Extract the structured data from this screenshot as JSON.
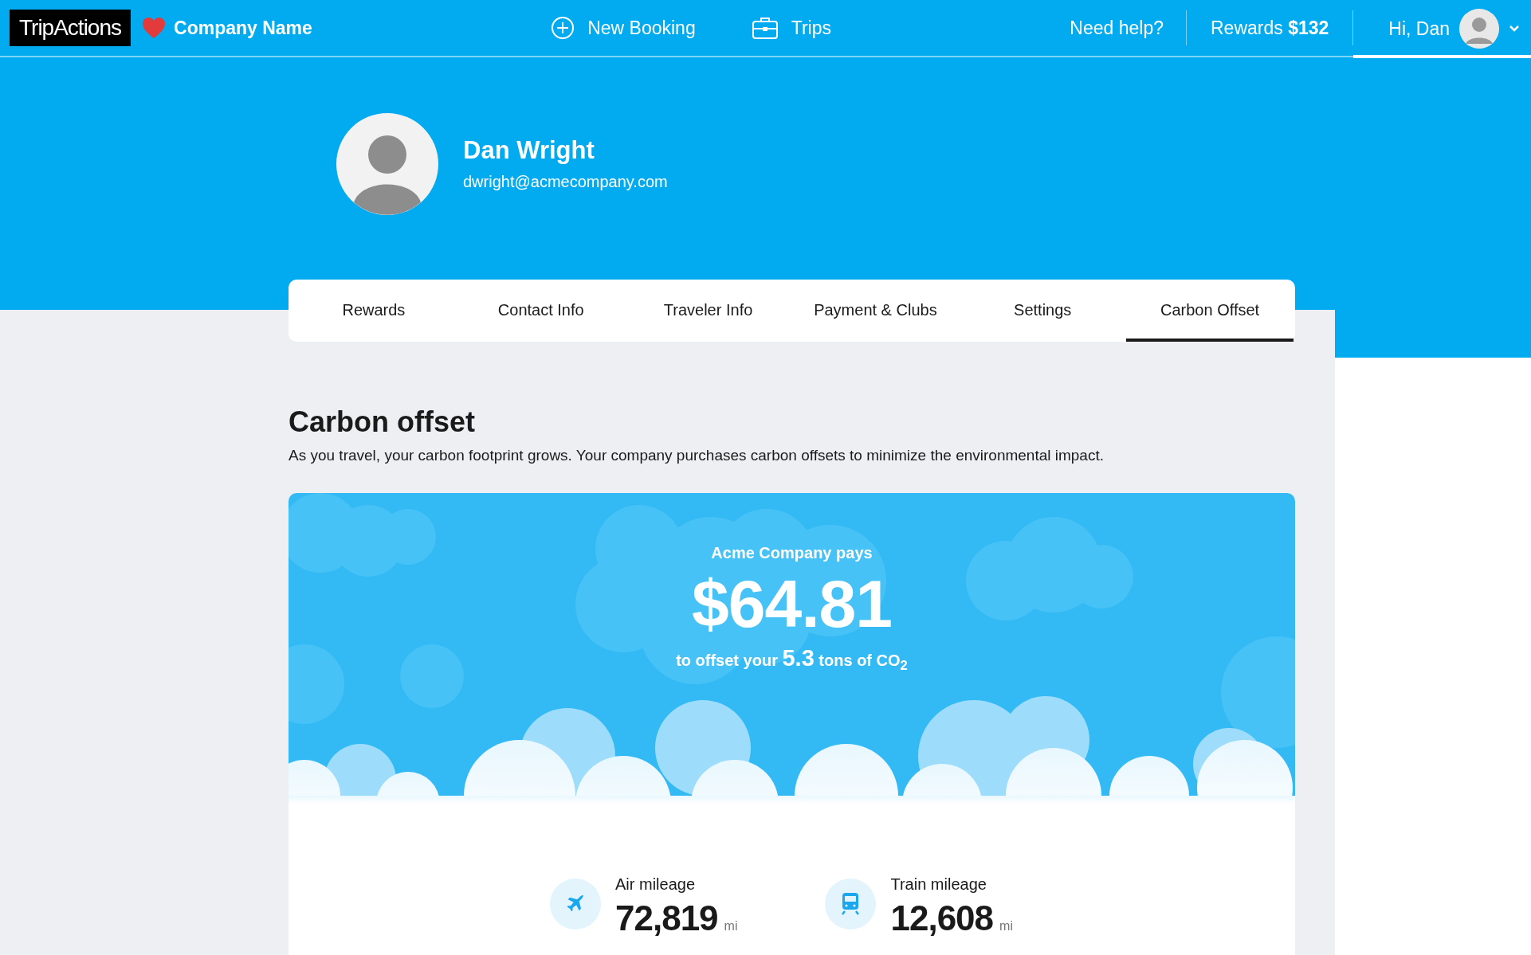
{
  "topbar": {
    "logo": "TripActions",
    "company": "Company Name",
    "nav": [
      {
        "kind": "booking",
        "label": "New Booking"
      },
      {
        "kind": "trips",
        "label": "Trips"
      }
    ],
    "help": "Need help?",
    "rewards": "Rewards **$132**",
    "greeting": "Hi, Dan"
  },
  "profile": {
    "name": "Dan Wright",
    "email": "dwright@acmecompany.com"
  },
  "tabs": [
    {
      "label": "Rewards",
      "selected": false
    },
    {
      "label": "Contact Info",
      "selected": false
    },
    {
      "label": "Traveler Info",
      "selected": false
    },
    {
      "label": "Payment & Clubs",
      "selected": false
    },
    {
      "label": "Settings",
      "selected": false
    },
    {
      "label": "Carbon Offset",
      "selected": true
    }
  ],
  "section": {
    "title": "Carbon offset",
    "description": "As you travel, your carbon footprint grows. Your company purchases carbon offsets to minimize the environmental impact."
  },
  "offset": {
    "payer": "Acme Company pays",
    "amount": "$64.81",
    "detail": "to offset your **5.3** tons of CO$_{2}$"
  },
  "mileage": [
    {
      "kind": "air",
      "label": "Air mileage",
      "value": "72,819",
      "unit": "mi"
    },
    {
      "kind": "train",
      "label": "Train mileage",
      "value": "12,608",
      "unit": "mi"
    }
  ]
}
